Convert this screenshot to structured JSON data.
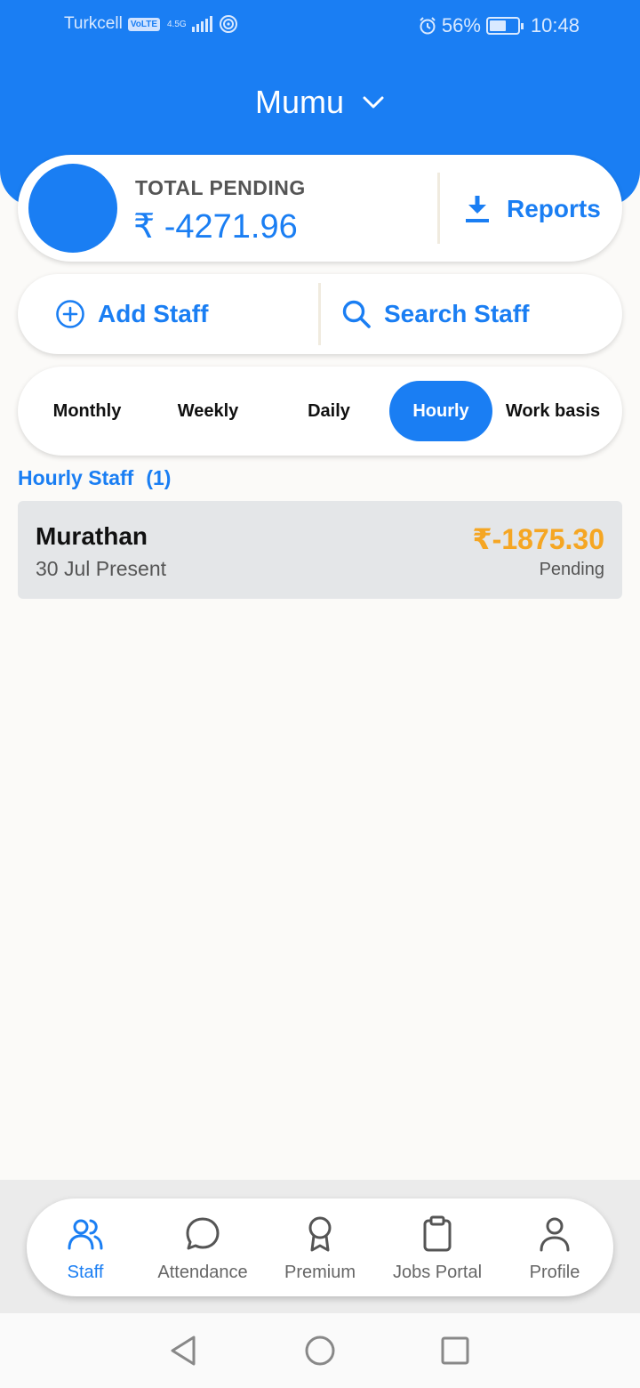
{
  "status_bar": {
    "carrier": "Turkcell",
    "volte": "VoLTE",
    "network": "4.5G",
    "battery": "56%",
    "time": "10:48"
  },
  "header": {
    "business_name": "Mumu"
  },
  "summary": {
    "pending_label": "TOTAL PENDING",
    "pending_amount": "₹ -4271.96",
    "reports_label": "Reports"
  },
  "actions": {
    "add_staff": "Add Staff",
    "search_staff": "Search Staff"
  },
  "tabs": [
    {
      "label": "Monthly",
      "active": false
    },
    {
      "label": "Weekly",
      "active": false
    },
    {
      "label": "Daily",
      "active": false
    },
    {
      "label": "Hourly",
      "active": true
    },
    {
      "label": "Work basis",
      "active": false
    }
  ],
  "section": {
    "title": "Hourly Staff",
    "count": "(1)"
  },
  "staff": [
    {
      "name": "Murathan",
      "subtitle": "30 Jul Present",
      "amount": "₹-1875.30",
      "status": "Pending"
    }
  ],
  "bottom_nav": [
    {
      "label": "Staff",
      "icon": "users-icon",
      "active": true
    },
    {
      "label": "Attendance",
      "icon": "chat-bubble-icon",
      "active": false
    },
    {
      "label": "Premium",
      "icon": "award-icon",
      "active": false
    },
    {
      "label": "Jobs Portal",
      "icon": "clipboard-icon",
      "active": false
    },
    {
      "label": "Profile",
      "icon": "user-icon",
      "active": false
    }
  ],
  "colors": {
    "primary": "#1a7ef3",
    "pending_amount": "#f5a623",
    "background": "#fbfaf8"
  }
}
